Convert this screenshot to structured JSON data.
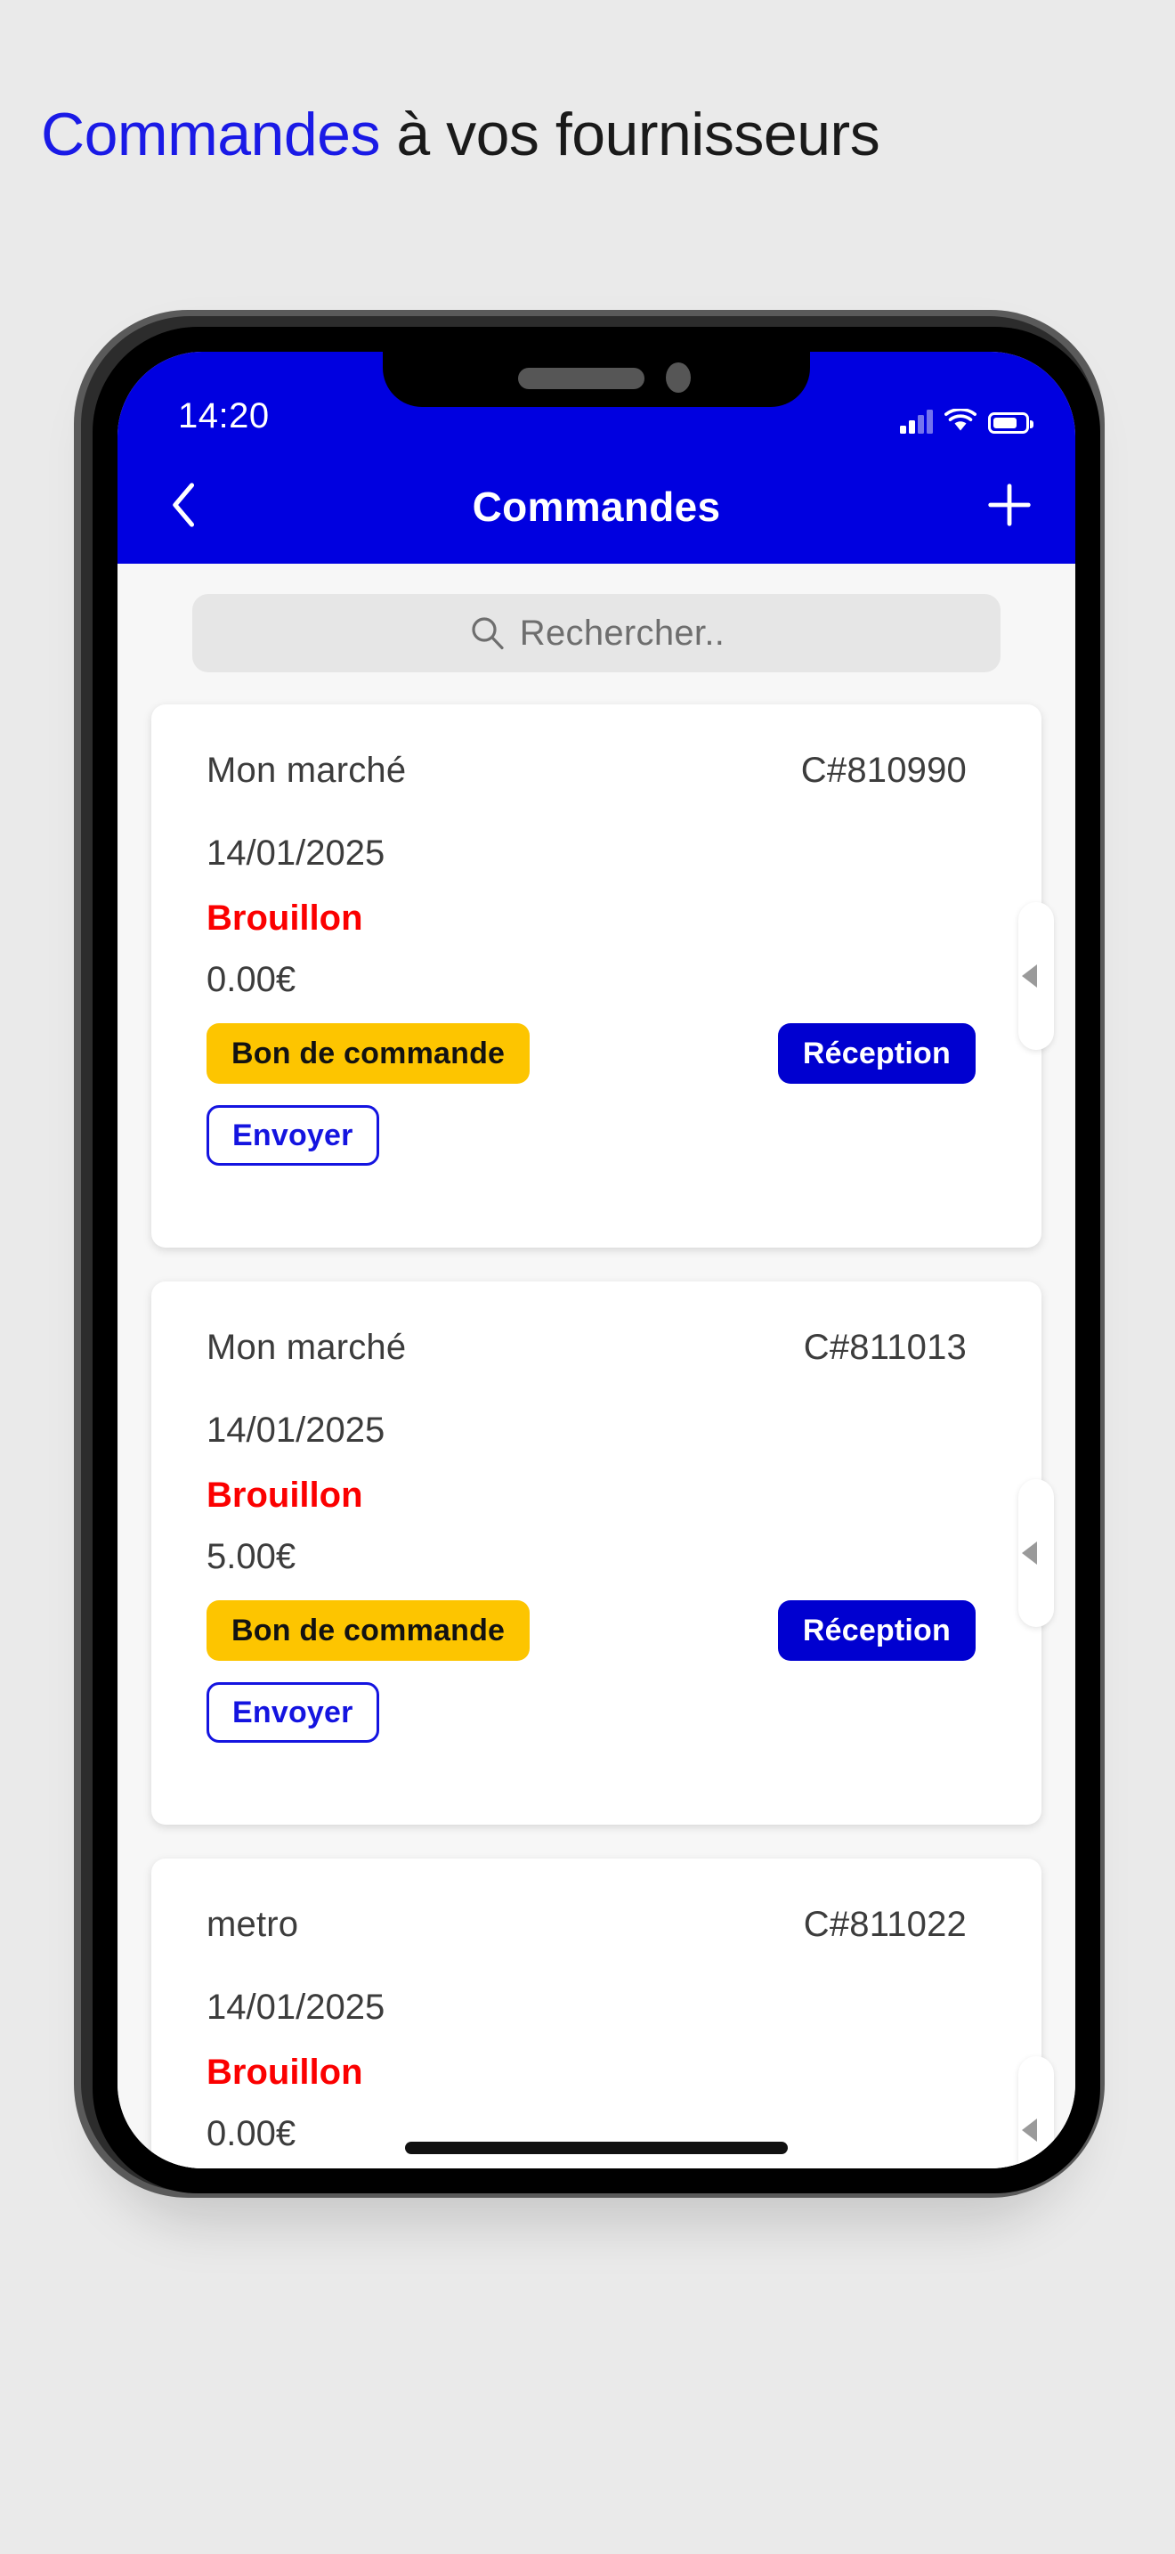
{
  "page": {
    "heading_highlight": "Commandes",
    "heading_rest": " à vos fournisseurs",
    "accent_blue": "#0000e0",
    "accent_yellow": "#fdc500",
    "status_red": "#fb0000"
  },
  "status_bar": {
    "time": "14:20",
    "signal_icon": "cellular-signal-icon",
    "wifi_icon": "wifi-icon",
    "battery_icon": "battery-icon"
  },
  "nav": {
    "back_icon": "chevron-left-icon",
    "title": "Commandes",
    "add_icon": "plus-icon"
  },
  "search": {
    "icon": "search-icon",
    "placeholder": "Rechercher.."
  },
  "buttons": {
    "bon_de_commande": "Bon de commande",
    "reception": "Réception",
    "envoyer": "Envoyer"
  },
  "orders": [
    {
      "supplier": "Mon marché",
      "number": "C#810990",
      "date": "14/01/2025",
      "status": "Brouillon",
      "amount": "0.00€"
    },
    {
      "supplier": "Mon marché",
      "number": "C#811013",
      "date": "14/01/2025",
      "status": "Brouillon",
      "amount": "5.00€"
    },
    {
      "supplier": "metro",
      "number": "C#811022",
      "date": "14/01/2025",
      "status": "Brouillon",
      "amount": "0.00€"
    }
  ]
}
